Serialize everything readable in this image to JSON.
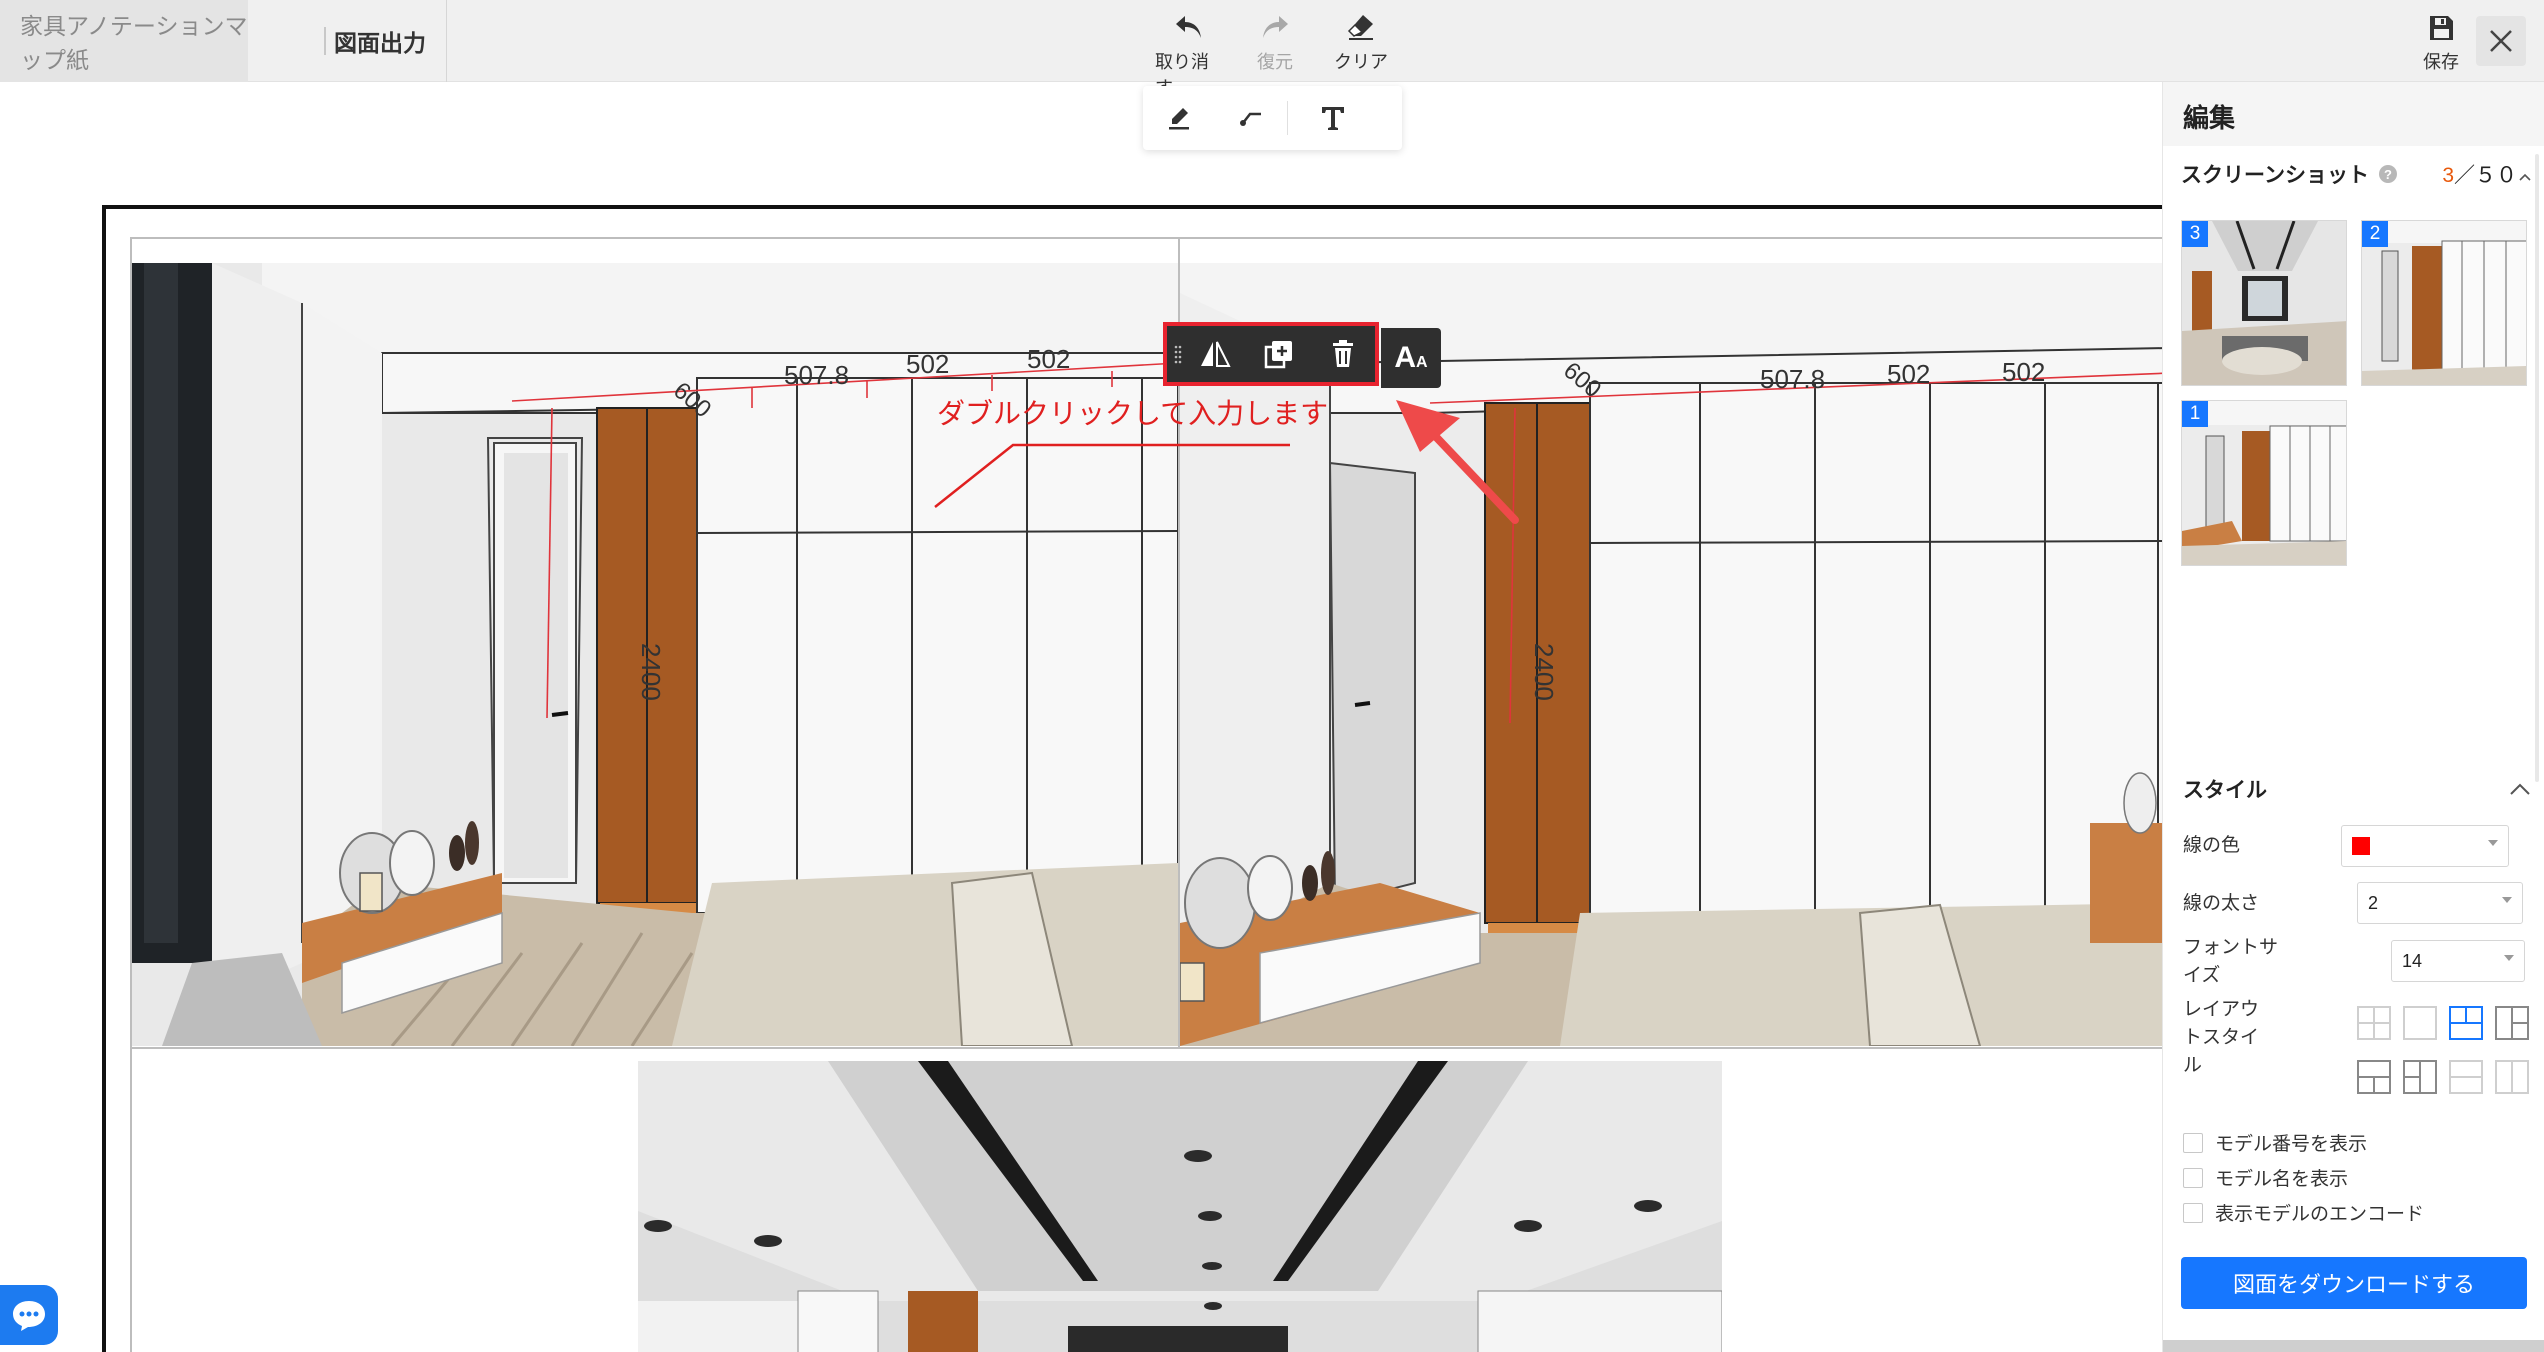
{
  "header": {
    "breadcrumb_prev": "家具アノテーションマップ紙",
    "breadcrumb_current": "図面出力",
    "undo_label": "取り消す",
    "redo_label": "復元",
    "clear_label": "クリア",
    "save_label": "保存"
  },
  "tools": [
    "pen-icon",
    "line-icon",
    "text-icon"
  ],
  "canvas": {
    "annotation_text": "ダブルクリックして入力します",
    "dims_left": [
      "507.8",
      "502",
      "502",
      "600",
      "2400"
    ],
    "dims_right": [
      "507.8",
      "502",
      "502",
      "600",
      "2400"
    ],
    "selection_toolbar": [
      "flip-icon",
      "duplicate-icon",
      "delete-icon"
    ],
    "font_button": "A",
    "font_button_small": "A"
  },
  "panel": {
    "title": "編集",
    "screenshots_label": "スクリーンショット",
    "count_current": "3",
    "count_sep": "／",
    "count_total": "５０",
    "thumbnails": [
      {
        "badge": "3"
      },
      {
        "badge": "2"
      },
      {
        "badge": "1"
      }
    ],
    "style_label": "スタイル",
    "line_color_label": "線の色",
    "line_color_value": "#ff0000",
    "line_width_label": "線の太さ",
    "line_width_value": "2",
    "font_size_label_1": "フォントサ",
    "font_size_label_2": "イズ",
    "font_size_value": "14",
    "layout_label_1": "レイアウ",
    "layout_label_2": "トスタイ",
    "layout_label_3": "ル",
    "checkbox_model_number": "モデル番号を表示",
    "checkbox_model_name": "モデル名を表示",
    "checkbox_encode": "表示モデルのエンコード",
    "download_button": "図面をダウンロードする"
  }
}
